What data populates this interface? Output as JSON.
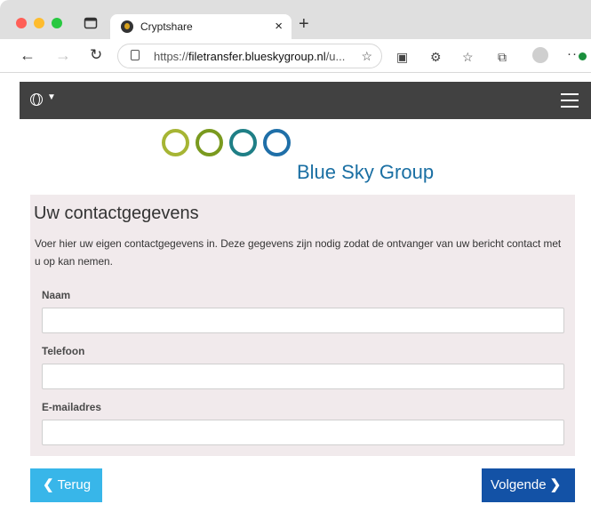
{
  "browser": {
    "tab_title": "Cryptshare",
    "tab_close": "×",
    "new_tab": "+",
    "url_prefix": "https://",
    "url_domain": "filetransfer.blueskygroup.nl",
    "url_suffix": "/u..."
  },
  "logo": {
    "brand": "Blue Sky Group",
    "ring_colors": [
      "#a6b534",
      "#7a9a1f",
      "#1f7f86",
      "#1f6fa8"
    ]
  },
  "form": {
    "title": "Uw contactgegevens",
    "intro": "Voer hier uw eigen contactgegevens in. Deze gegevens zijn nodig zodat de ontvanger van uw bericht contact met u op kan nemen.",
    "name_label": "Naam",
    "name_value": "",
    "phone_label": "Telefoon",
    "phone_value": "",
    "email_label": "E-mailadres",
    "email_value": ""
  },
  "buttons": {
    "back_label": "Terug",
    "next_label": "Volgende"
  },
  "colors": {
    "back_button": "#38b6e9",
    "next_button": "#1352a6",
    "panel_bg": "#f1eaec",
    "topbar": "#414141"
  }
}
